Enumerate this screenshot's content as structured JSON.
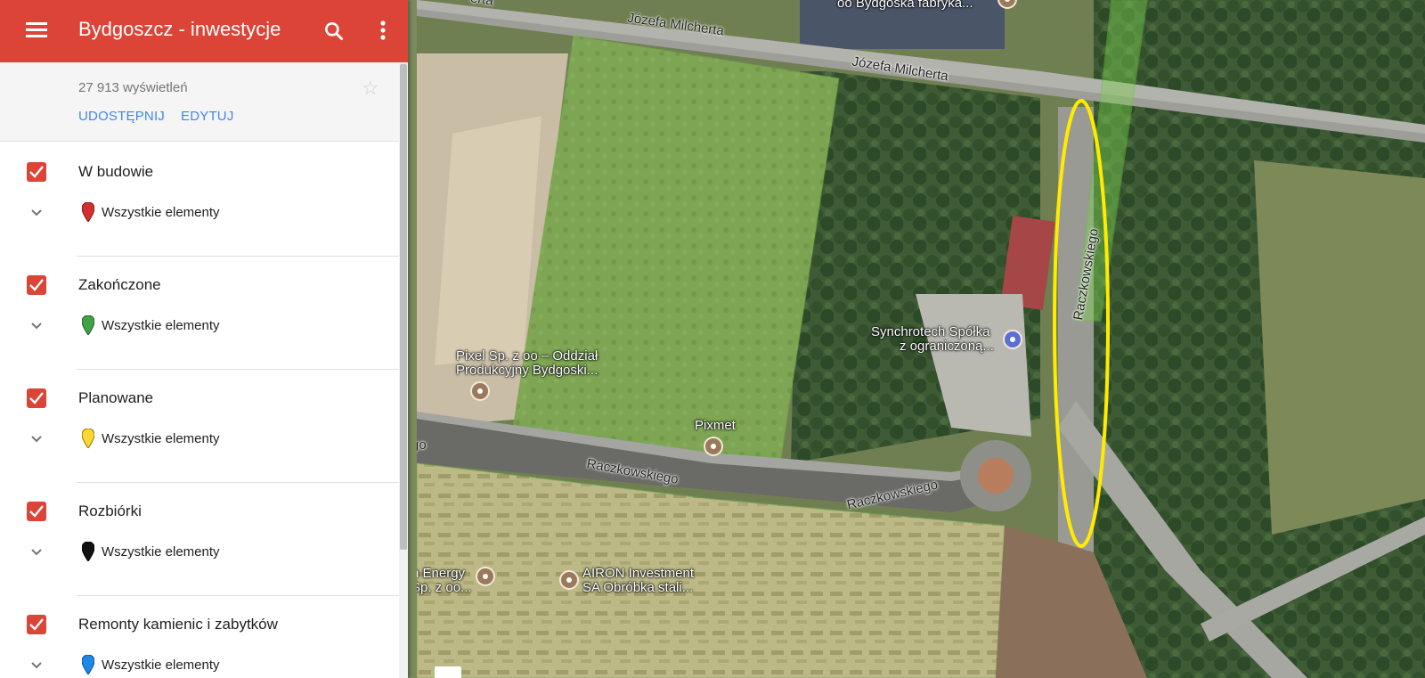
{
  "app": {
    "title": "Bydgoszcz - inwestycje",
    "accent": "#db4437",
    "link_color": "#4285f4"
  },
  "toolbar": {
    "menu_icon": "menu-icon",
    "search_icon": "search-icon",
    "more_icon": "more-vert-icon"
  },
  "info": {
    "views": "27 913 wyświetleń",
    "share_label": "UDOSTĘPNIJ",
    "edit_label": "EDYTUJ",
    "star_icon": "star-outline-icon"
  },
  "layers": [
    {
      "name": "W budowie",
      "checked": true,
      "items_label": "Wszystkie elementy",
      "pin_color": "#d32f2f"
    },
    {
      "name": "Zakończone",
      "checked": true,
      "items_label": "Wszystkie elementy",
      "pin_color": "#43a047"
    },
    {
      "name": "Planowane",
      "checked": true,
      "items_label": "Wszystkie elementy",
      "pin_color": "#fdd835"
    },
    {
      "name": "Rozbiórki",
      "checked": true,
      "items_label": "Wszystkie elementy",
      "pin_color": "#111111"
    },
    {
      "name": "Remonty kamienic i zabytków",
      "checked": true,
      "items_label": "Wszystkie elementy",
      "pin_color": "#1e88e5"
    }
  ],
  "map": {
    "streets": {
      "milcherta_1": "Józefa Milcherta",
      "milcherta_2": "Józefa Milcherta",
      "raczkowskiego_1": "Raczkowskiego",
      "raczkowskiego_2": "Raczkowskiego",
      "raczkowskiego_3": "Raczkowskiego",
      "edge_go": "go",
      "edge_top": "erta"
    },
    "places": {
      "top_factory": "oo Bydgoska fabryka...",
      "pixel_line1": "Pixel Sp. z oo – Oddział",
      "pixel_line2": "Produkcyjny Bydgoski...",
      "pixmet": "Pixmet",
      "synchrotech_line1": "Synchrotech Spółka",
      "synchrotech_line2": "z ograniczoną...",
      "energy_line1": "n Energy",
      "energy_line2": "Sp. z oo...",
      "airon_line1": "AIRON Investment",
      "airon_line2": "SA Obróbka stali..."
    },
    "highlight_color": "#ffeb00"
  }
}
